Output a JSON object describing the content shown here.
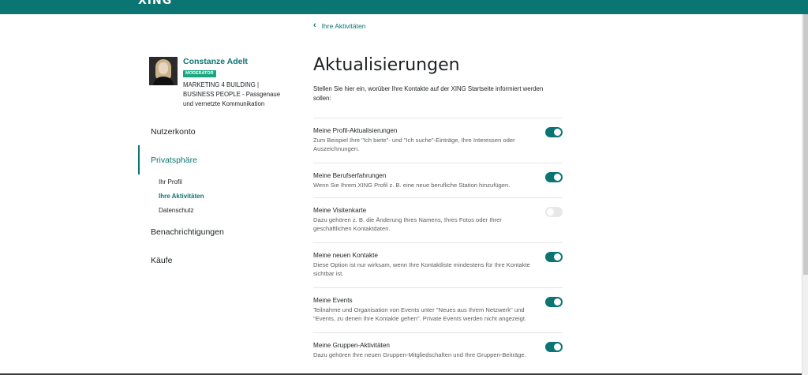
{
  "header": {
    "logo": "XING",
    "brand_color": "#0b7574"
  },
  "breadcrumb": {
    "back_label": "Ihre Aktivitäten"
  },
  "profile": {
    "name": "Constanze Adelt",
    "badge": "MODERATOR",
    "description": "MARKETING 4 BUILDING | BUSINESS PEOPLE - Passgenaue und vernetzte Kommunikation"
  },
  "sidebar": {
    "items": [
      {
        "label": "Nutzerkonto"
      },
      {
        "label": "Privatsphäre",
        "active": true
      },
      {
        "label": "Benachrichtigungen"
      },
      {
        "label": "Käufe"
      }
    ],
    "subitems": [
      {
        "label": "Ihr Profil"
      },
      {
        "label": "Ihre Aktivitäten",
        "active": true
      },
      {
        "label": "Datenschutz"
      }
    ]
  },
  "main": {
    "title": "Aktualisierungen",
    "intro": "Stellen Sie hier ein, worüber Ihre Kontakte auf der XING Startseite informiert werden sollen:",
    "settings": [
      {
        "title": "Meine Profil-Aktualisierungen",
        "description": "Zum Beispiel Ihre \"Ich biete\"- und \"Ich suche\"-Einträge, Ihre Interessen oder Auszeichnungen.",
        "enabled": true
      },
      {
        "title": "Meine Berufserfahrungen",
        "description": "Wenn Sie Ihrem XING Profil z. B. eine neue berufliche Station hinzufügen.",
        "enabled": true
      },
      {
        "title": "Meine Visitenkarte",
        "description": "Dazu gehören z. B. die Änderung Ihres Namens, Ihres Fotos oder Ihrer geschäftlichen Kontaktdaten.",
        "enabled": false
      },
      {
        "title": "Meine neuen Kontakte",
        "description": "Diese Option ist nur wirksam, wenn Ihre Kontaktliste mindestens für Ihre Kontakte sichtbar ist.",
        "enabled": true
      },
      {
        "title": "Meine Events",
        "description": "Teilnahme und Organisation von Events unter \"Neues aus Ihrem Netzwerk\" und \"Events, zu denen Ihre Kontakte gehen\". Private Events werden nicht angezeigt.",
        "enabled": true
      },
      {
        "title": "Meine Gruppen-Aktivitäten",
        "description": "Dazu gehören Ihre neuen Gruppen-Mitgliedschaften und Ihre Gruppen-Beiträge.",
        "enabled": true
      }
    ]
  }
}
